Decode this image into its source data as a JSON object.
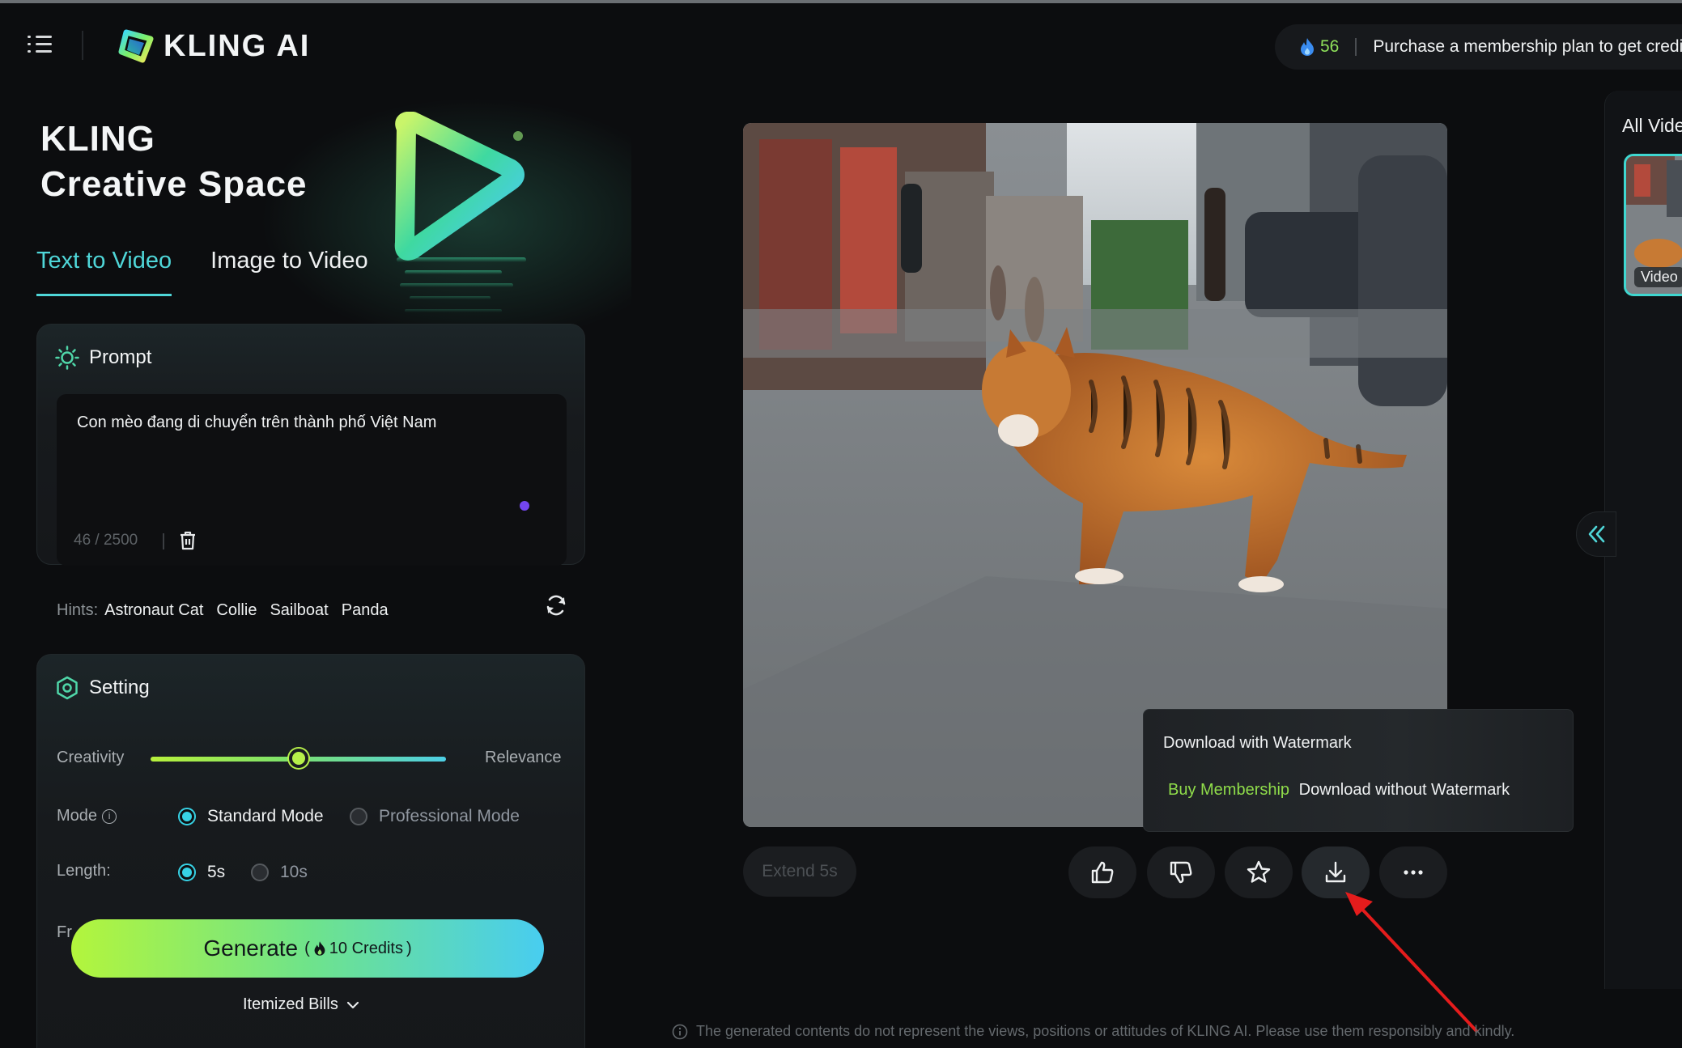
{
  "header": {
    "logo_text": "KLING AI",
    "credits": "56",
    "purchase_text": "Purchase a membership plan to get credi"
  },
  "hero": {
    "title_line1": "KLING",
    "title_line2": "Creative Space"
  },
  "tabs": [
    {
      "label": "Text to Video",
      "active": true
    },
    {
      "label": "Image to Video",
      "active": false
    }
  ],
  "prompt": {
    "heading": "Prompt",
    "text": "Con mèo đang di chuyển trên thành phố Việt Nam",
    "counter": "46 / 2500",
    "hints_label": "Hints:",
    "hints": [
      "Astronaut Cat",
      "Collie",
      "Sailboat",
      "Panda"
    ]
  },
  "setting": {
    "heading": "Setting",
    "creativity_label": "Creativity",
    "relevance_label": "Relevance",
    "slider_value": 0.5,
    "mode_label": "Mode",
    "modes": [
      {
        "label": "Standard Mode",
        "selected": true
      },
      {
        "label": "Professional Mode",
        "selected": false
      }
    ],
    "length_label": "Length:",
    "lengths": [
      {
        "label": "5s",
        "selected": true
      },
      {
        "label": "10s",
        "selected": false
      }
    ],
    "partial_label": "Fr"
  },
  "generate": {
    "label": "Generate",
    "credits": "10 Credits",
    "open_paren": "(",
    "close_paren": ")"
  },
  "itemized_label": "Itemized Bills",
  "tooltip": {
    "download_watermark": "Download with Watermark",
    "buy_membership": "Buy Membership",
    "download_no_watermark": "Download without Watermark"
  },
  "extend_label": "Extend 5s",
  "disclaimer": "The generated contents do not represent the views, positions or attitudes of KLING AI. Please use them responsibly and kindly.",
  "right_panel": {
    "title": "All Vide",
    "thumb_badge": "Video"
  },
  "colors": {
    "accent_cyan": "#4fd6d8",
    "credit_green": "#8ee05a",
    "buy_green": "#8fdc4a",
    "background": "#0c0d0f"
  },
  "icons": [
    "menu-icon",
    "kling-logo-icon",
    "flame-icon",
    "sun-icon",
    "trash-icon",
    "refresh-icon",
    "hexagon-settings-icon",
    "info-icon",
    "chevron-down-icon",
    "thumbs-up-icon",
    "thumbs-down-icon",
    "star-icon",
    "download-icon",
    "more-icon",
    "double-chevron-left-icon"
  ]
}
